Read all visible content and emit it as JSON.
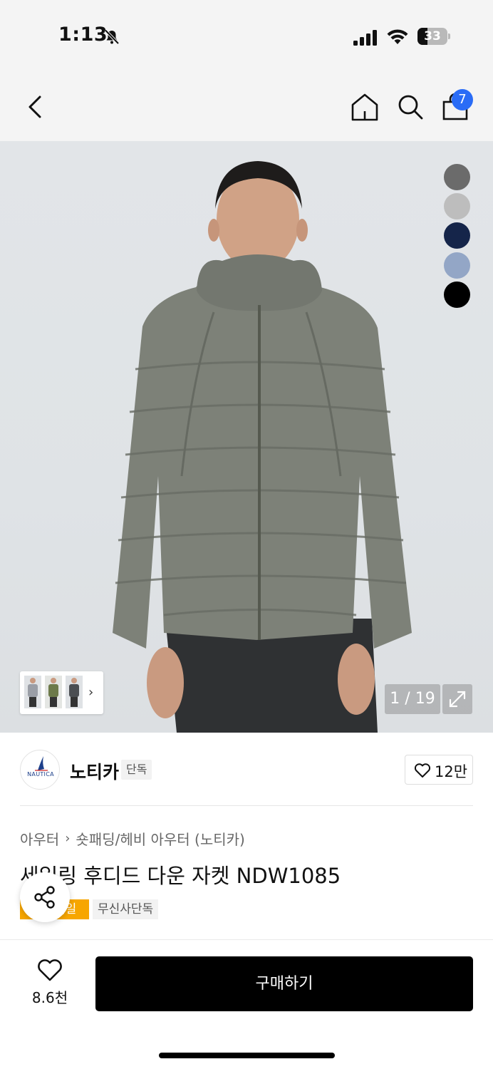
{
  "status": {
    "time": "1:13",
    "battery": "33",
    "battery_level": 0.33,
    "icons": [
      "bell-muted-icon",
      "cellular-signal-icon",
      "wifi-icon",
      "battery-icon"
    ]
  },
  "nav": {
    "icons": [
      "back-chevron-icon",
      "home-icon",
      "search-icon",
      "shopping-bag-icon"
    ],
    "cart_count": "7"
  },
  "gallery": {
    "pager": "1 / 19",
    "swatches": [
      "#6b6b6b",
      "#bdbdbd",
      "#15254a",
      "#93a6c6",
      "#000000"
    ]
  },
  "brand": {
    "logo_text": "NAUTICA",
    "name": "노티카",
    "tag": "단독",
    "likes": "12만"
  },
  "product": {
    "breadcrumb": [
      "아우터",
      "숏패딩/헤비 아우터 (노티카)"
    ],
    "title": "세일링 후디드 다운 자켓 NDW1085",
    "badges": [
      "세일",
      "무신사단독"
    ]
  },
  "bottom": {
    "wish_count": "8.6천",
    "buy_label": "구매하기"
  },
  "colors": {
    "accent_blue": "#2a6cf6",
    "sale_orange": "#f7a600",
    "buy_black": "#000000"
  }
}
